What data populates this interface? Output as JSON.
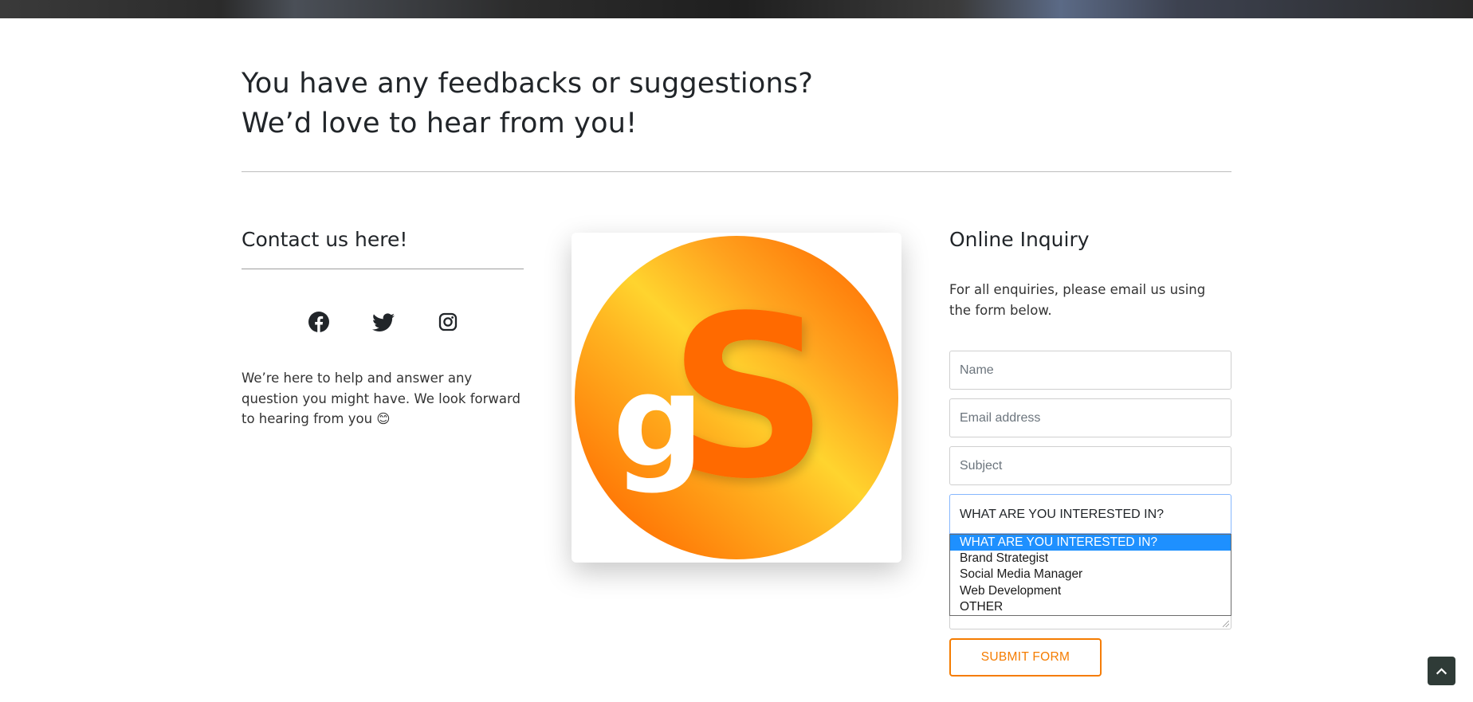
{
  "headline": {
    "line1": "You have any feedbacks or suggestions?",
    "line2": "We’d love to hear from you!"
  },
  "contact": {
    "title": "Contact us here!",
    "social": [
      {
        "icon": "facebook-icon"
      },
      {
        "icon": "twitter-icon"
      },
      {
        "icon": "instagram-icon"
      }
    ],
    "text": "We’re here to help and answer any question you might have. We look forward to hearing from you 😊"
  },
  "logo": {
    "text_g": "g",
    "text_s": "S"
  },
  "inquiry": {
    "title": "Online Inquiry",
    "description": "For all enquiries, please email us using the form below.",
    "fields": {
      "name_placeholder": "Name",
      "email_placeholder": "Email address",
      "subject_placeholder": "Subject"
    },
    "select": {
      "selected": "WHAT ARE YOU INTERESTED IN?",
      "options": [
        "WHAT ARE YOU INTERESTED IN?",
        "Brand Strategist",
        "Social Media Manager",
        "Web Development",
        "OTHER"
      ]
    },
    "submit_label": "SUBMIT FORM"
  },
  "colors": {
    "accent": "#f57c00",
    "selected_option": "#1e90ff",
    "scroll_top_bg": "#2f3b37"
  }
}
